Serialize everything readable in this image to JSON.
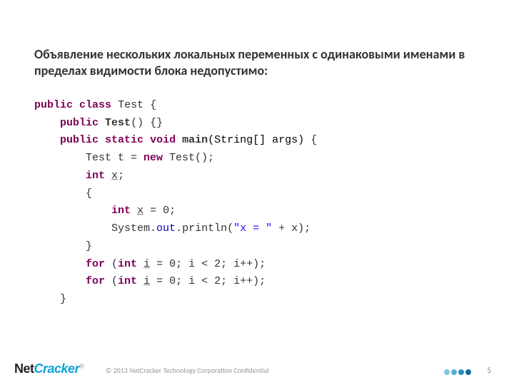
{
  "heading": "Объявление нескольких локальных переменных с одинаковыми именами в пределах видимости блока недопустимо:",
  "code": {
    "l1": {
      "kw1": "public",
      "kw2": "class",
      "name": "Test",
      "brace": "{"
    },
    "l2": {
      "kw": "public",
      "name": "Test",
      "paren": "()",
      "body": "{}"
    },
    "l3": {
      "kw1": "public",
      "kw2": "static",
      "kw3": "void",
      "name": "main",
      "args": "(String[] args)",
      "brace": "{"
    },
    "l4": {
      "txt1": "Test t = ",
      "kw": "new",
      "txt2": " Test();"
    },
    "l5": {
      "kw": "int",
      "sp": " ",
      "var": "x",
      "semi": ";"
    },
    "l6": {
      "brace": "{"
    },
    "l7": {
      "kw": "int",
      "sp": " ",
      "var": "x",
      "rest": " = 0;"
    },
    "l8": {
      "a": "System.",
      "out": "out",
      "b": ".println(",
      "str": "\"x = \"",
      "c": " + x);"
    },
    "l9": {
      "brace": "}"
    },
    "l10": {
      "kw1": "for",
      "p": " (",
      "kw2": "int",
      "sp": " ",
      "var": "i",
      "rest": " = 0; i < 2; i++);"
    },
    "l11": {
      "kw1": "for",
      "p": " (",
      "kw2": "int",
      "sp": " ",
      "var": "i",
      "rest": " = 0; i < 2; i++);"
    },
    "l12": {
      "brace": "}"
    }
  },
  "footer": {
    "logo_net": "Net",
    "logo_cracker": "Cracker",
    "reg": "®",
    "copyright": "© 2013 NetCracker Technology Corporation Confidential",
    "dots": [
      "#7ec8e3",
      "#5aaed1",
      "#2e8bbd",
      "#0d6aa8"
    ],
    "page": "5"
  }
}
